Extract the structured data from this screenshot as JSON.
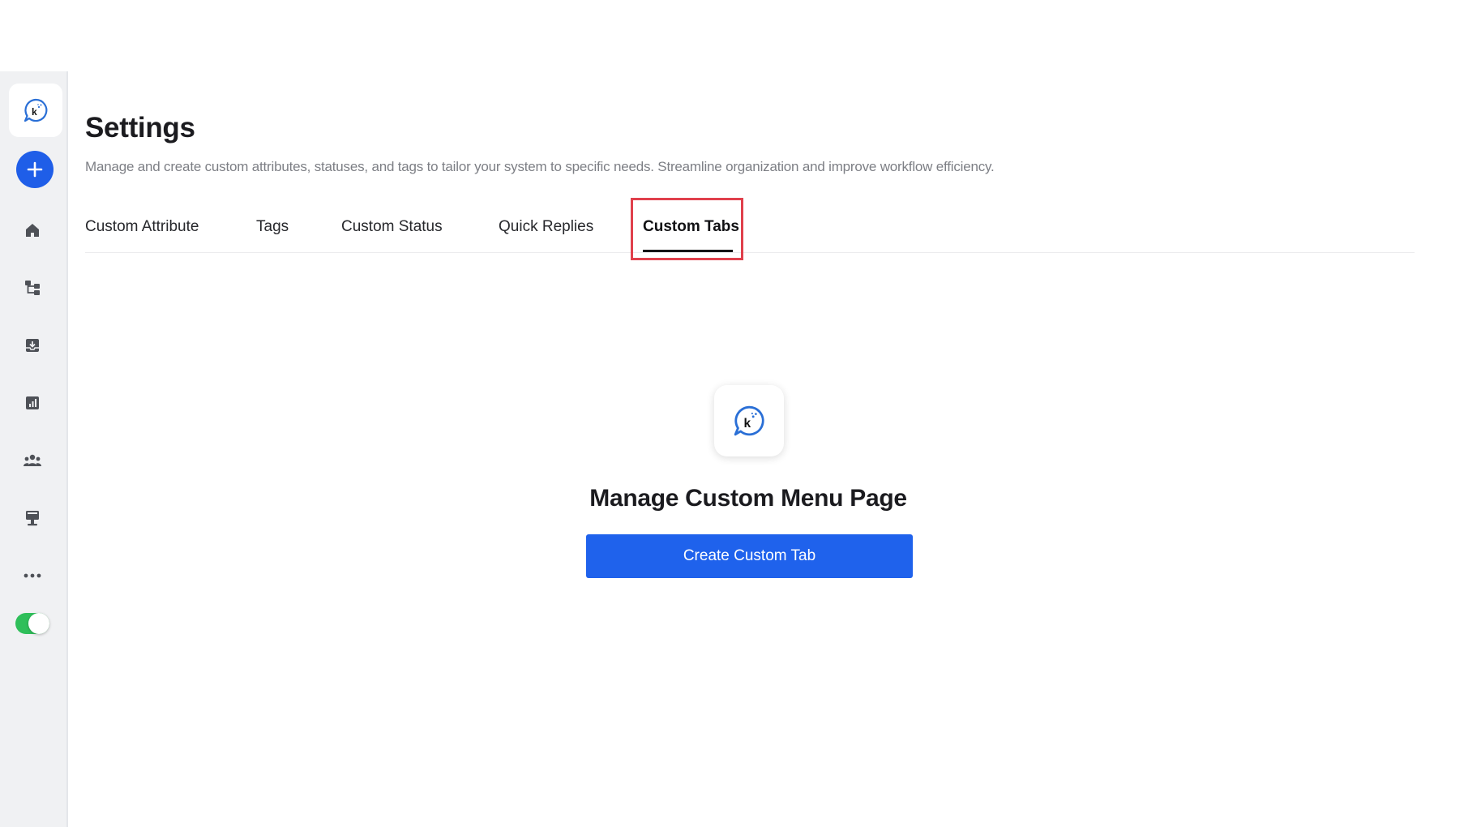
{
  "page": {
    "title": "Settings",
    "subtitle": "Manage and create custom attributes, statuses, and tags to tailor your system to specific needs. Streamline organization and improve workflow efficiency."
  },
  "tabs": [
    {
      "label": "Custom Attribute",
      "active": false
    },
    {
      "label": "Tags",
      "active": false
    },
    {
      "label": "Custom Status",
      "active": false
    },
    {
      "label": "Quick Replies",
      "active": false
    },
    {
      "label": "Custom Tabs",
      "active": true
    }
  ],
  "sidebar": {
    "logo_icon": "chat-bubble-k-logo",
    "add_icon": "plus-icon",
    "items": [
      {
        "icon": "home-icon"
      },
      {
        "icon": "workflow-icon"
      },
      {
        "icon": "inbox-icon"
      },
      {
        "icon": "reports-icon"
      },
      {
        "icon": "team-icon"
      },
      {
        "icon": "kiosk-icon"
      },
      {
        "icon": "more-icon"
      }
    ],
    "toggle_on": true
  },
  "empty_state": {
    "title": "Manage Custom Menu Page",
    "button_label": "Create Custom Tab"
  },
  "colors": {
    "accent": "#1f62ec",
    "highlight": "#e0404c",
    "toggle": "#2fbf5a",
    "sidebar_bg": "#f0f1f3"
  }
}
